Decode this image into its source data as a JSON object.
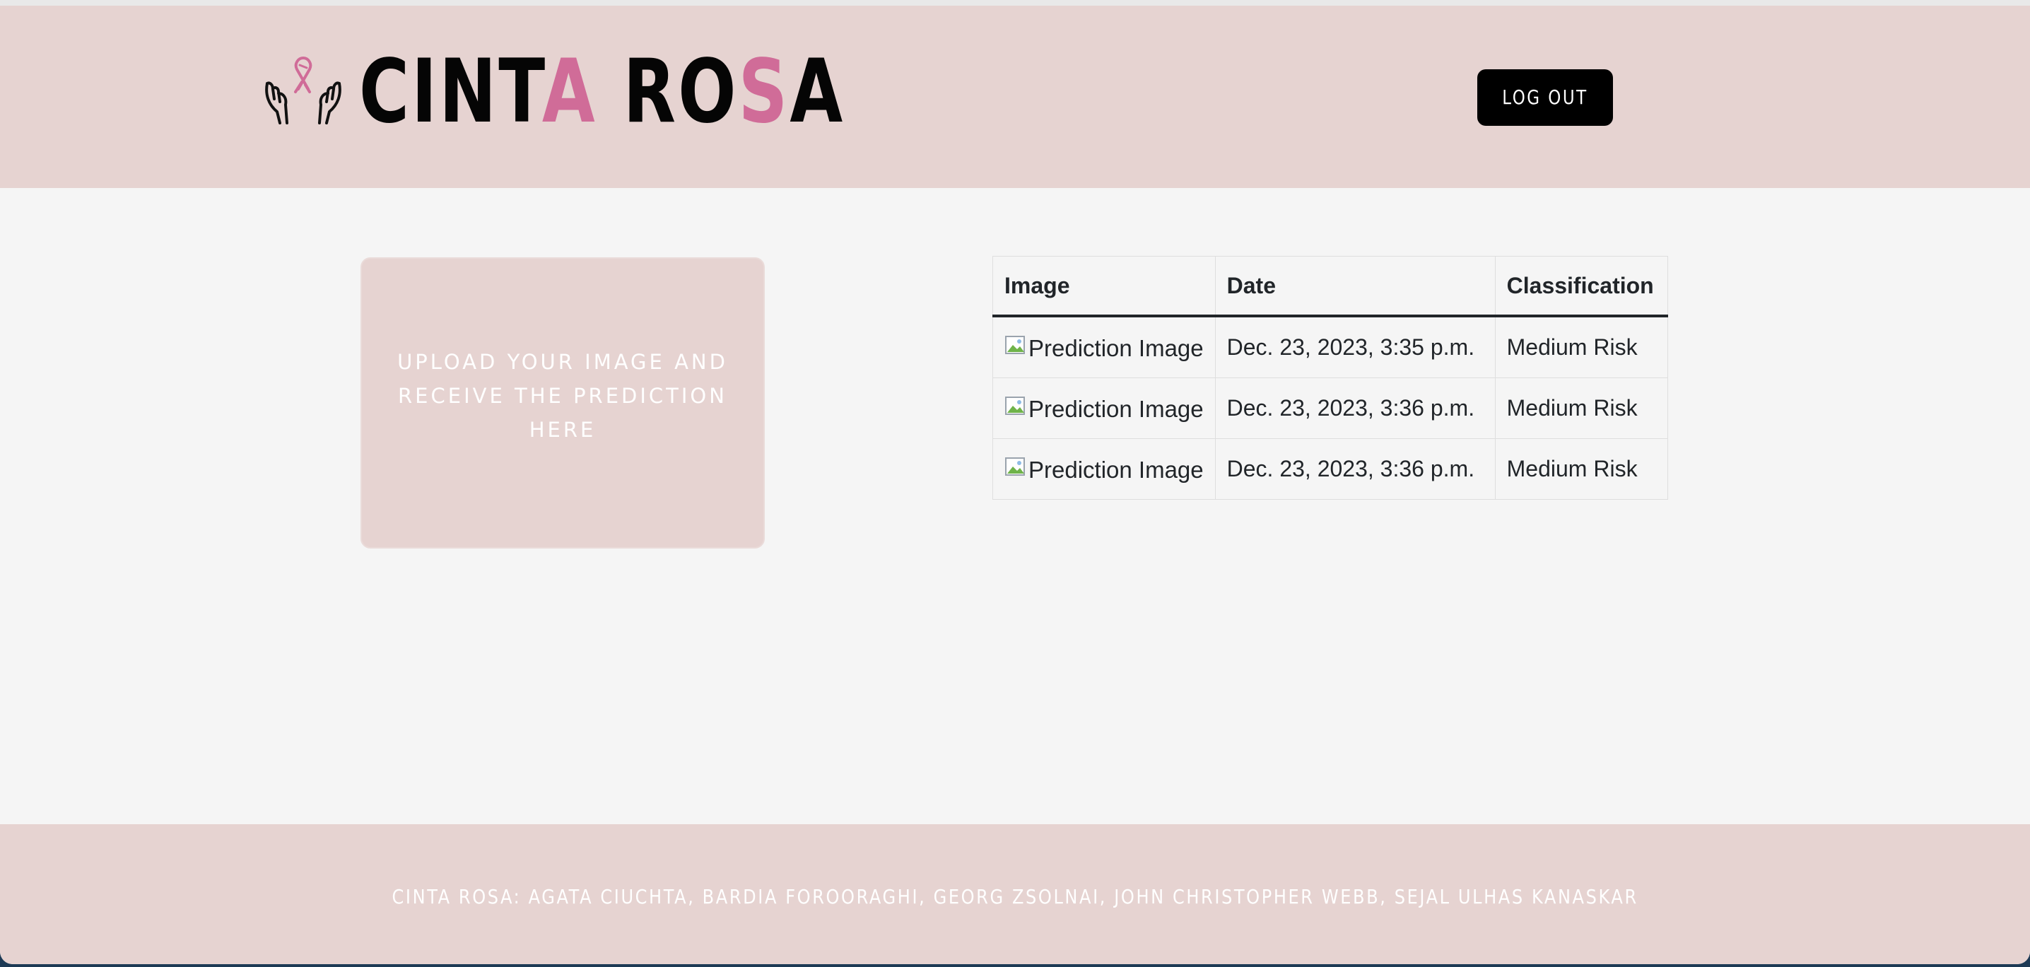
{
  "brand": {
    "logo_icon": "ribbon-in-hands-icon",
    "name_parts": [
      {
        "text": "CINT",
        "accent": false
      },
      {
        "text": "A",
        "accent": true
      },
      {
        "text": " RO",
        "accent": false
      },
      {
        "text": "S",
        "accent": true
      },
      {
        "text": "A",
        "accent": false
      }
    ]
  },
  "header": {
    "logout_label": "LOG OUT"
  },
  "upload": {
    "label": "UPLOAD YOUR IMAGE AND RECEIVE THE PREDICTION HERE"
  },
  "table": {
    "headers": [
      "Image",
      "Date",
      "Classification"
    ],
    "rows": [
      {
        "image_alt": "Prediction Image",
        "date": "Dec. 23, 2023, 3:35 p.m.",
        "classification": "Medium Risk"
      },
      {
        "image_alt": "Prediction Image",
        "date": "Dec. 23, 2023, 3:36 p.m.",
        "classification": "Medium Risk"
      },
      {
        "image_alt": "Prediction Image",
        "date": "Dec. 23, 2023, 3:36 p.m.",
        "classification": "Medium Risk"
      }
    ]
  },
  "footer": {
    "credits": "CINTA ROSA: AGATA CIUCHTA, BARDIA FOROORAGHI, GEORG ZSOLNAI, JOHN CHRISTOPHER WEBB, SEJAL ULHAS KANASKAR"
  },
  "colors": {
    "brand_pink_bg": "#e6d3d1",
    "accent_pink": "#d06c98",
    "page_bg": "#f5f5f5",
    "button_bg": "#000000"
  }
}
